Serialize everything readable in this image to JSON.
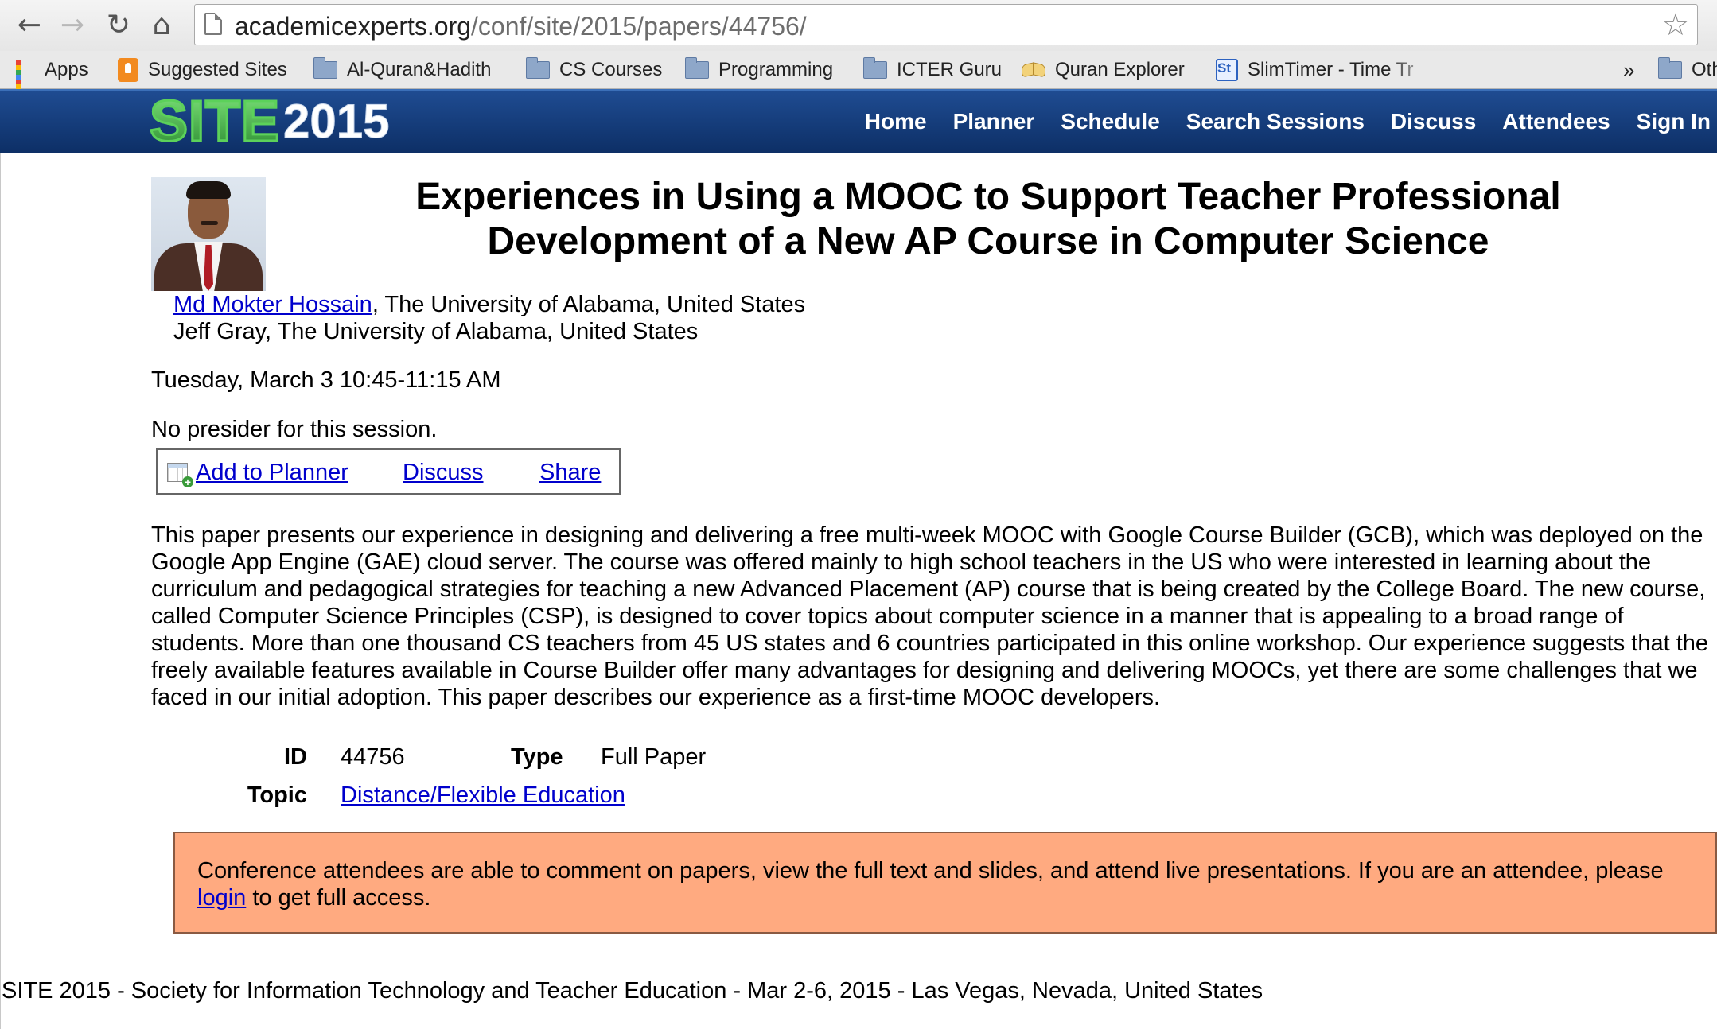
{
  "browser": {
    "url_host": "academicexperts.org",
    "url_path": "/conf/site/2015/papers/44756/",
    "nav_icons": [
      "back-arrow-icon",
      "forward-arrow-icon",
      "reload-icon",
      "home-icon"
    ],
    "bookmark_star_icon": "star-outline-icon"
  },
  "bookmarks": {
    "items": [
      {
        "label": "Apps",
        "icon": "apps-grid-icon"
      },
      {
        "label": "Suggested Sites",
        "icon": "suggested-sites-icon"
      },
      {
        "label": "Al-Quran&Hadith",
        "icon": "folder-icon"
      },
      {
        "label": "CS Courses",
        "icon": "folder-icon"
      },
      {
        "label": "Programming",
        "icon": "folder-icon"
      },
      {
        "label": "ICTER Guru",
        "icon": "folder-icon"
      },
      {
        "label": "Quran Explorer",
        "icon": "open-book-icon"
      },
      {
        "label": "SlimTimer - Time Tr",
        "icon": "slimtimer-icon"
      },
      {
        "label": "Oth",
        "icon": "folder-icon"
      }
    ],
    "overflow_label": "»"
  },
  "site": {
    "logo_text": "SITE",
    "logo_year": "2015",
    "nav": [
      "Home",
      "Planner",
      "Schedule",
      "Search Sessions",
      "Discuss",
      "Attendees",
      "Sign In"
    ],
    "header_color": "#1a427f",
    "logo_color": "#5cd15a"
  },
  "paper": {
    "title_line1": "Experiences in Using a MOOC to Support Teacher Professional",
    "title_line2": "Development of a New AP Course in Computer Science",
    "authors": [
      {
        "name": "Md Mokter Hossain",
        "affiliation": ", The University of Alabama, United States",
        "linked": true
      },
      {
        "name": "Jeff Gray",
        "affiliation": ", The University of Alabama, United States",
        "linked": false
      }
    ],
    "session_time": "Tuesday, March 3 10:45-11:15 AM",
    "presider": "No presider for this session.",
    "actions": {
      "add_to_planner": "Add to Planner",
      "discuss": "Discuss",
      "share": "Share"
    },
    "abstract": "This paper presents our experience in designing and delivering a free multi-week MOOC with Google Course Builder (GCB), which was deployed on the Google App Engine (GAE) cloud server. The course was offered mainly to high school teachers in the US who were interested in learning about the curriculum and pedagogical strategies for teaching a new Advanced Placement (AP) course that is being created by the College Board. The new course, called Computer Science Principles (CSP), is designed to cover topics about computer science in a manner that is appealing to a broad range of students. More than one thousand CS teachers from 45 US states and 6 countries participated in this online workshop. Our experience suggests that the freely available features available in Course Builder offer many advantages for designing and delivering MOOCs, yet there are some challenges that we faced in our initial adoption. This paper describes our experience as a first-time MOOC developers.",
    "meta": {
      "id_label": "ID",
      "id_value": "44756",
      "type_label": "Type",
      "type_value": "Full Paper",
      "topic_label": "Topic",
      "topic_value": "Distance/Flexible Education"
    }
  },
  "notice": {
    "text_before": "Conference attendees are able to comment on papers, view the full text and slides, and attend live presentations. If you are an attendee, please ",
    "link": "login",
    "text_after": " to get full access.",
    "bg_color": "#ffaa80"
  },
  "footer": {
    "text": "SITE 2015 - Society for Information Technology and Teacher Education - Mar 2-6, 2015 - Las Vegas, Nevada, United States"
  },
  "link_color": "#0000cc"
}
